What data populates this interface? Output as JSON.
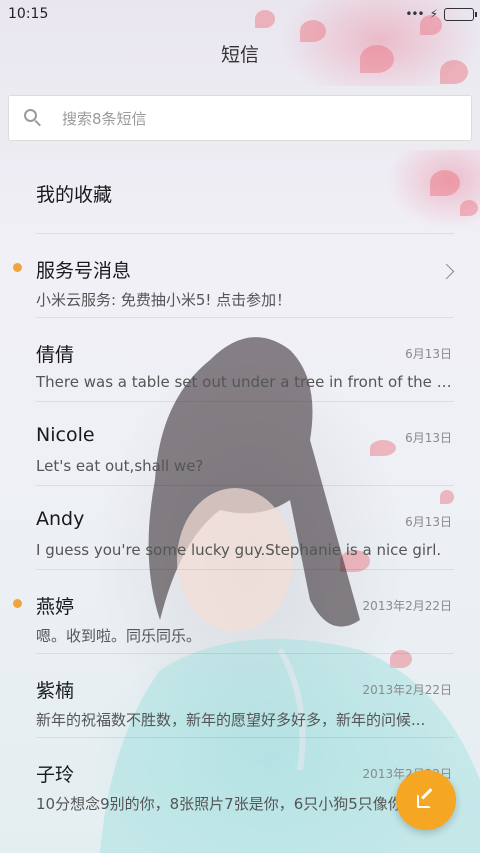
{
  "status_bar": {
    "time": "10:15",
    "icons": [
      "signal-dots-icon",
      "charging-bolt-icon",
      "battery-icon"
    ],
    "battery_color": "#4ccf3b"
  },
  "header": {
    "title": "短信"
  },
  "search": {
    "placeholder": "搜索8条短信",
    "icon": "search-icon"
  },
  "conversations": [
    {
      "name": "我的收藏",
      "preview": "",
      "date": "",
      "unread": false,
      "chevron": false
    },
    {
      "name": "服务号消息",
      "preview": "小米云服务: 免费抽小米5! 点击参加！",
      "date": "",
      "unread": true,
      "chevron": true
    },
    {
      "name": "倩倩",
      "preview": "There was a table set out under a tree in front of the ho...",
      "date": "6月13日",
      "unread": false,
      "chevron": false
    },
    {
      "name": "Nicole",
      "preview": "Let's eat out,shall we?",
      "date": "6月13日",
      "unread": false,
      "chevron": false
    },
    {
      "name": "Andy",
      "preview": "I guess you're some lucky guy.Stephanie is a nice girl.",
      "date": "6月13日",
      "unread": false,
      "chevron": false
    },
    {
      "name": "燕婷",
      "preview": "嗯。收到啦。同乐同乐。",
      "date": "2013年2月22日",
      "unread": true,
      "chevron": false
    },
    {
      "name": "紫楠",
      "preview": "新年的祝福数不胜数，新年的愿望好多好多，新年的问候...",
      "date": "2013年2月22日",
      "unread": false,
      "chevron": false
    },
    {
      "name": "子玲",
      "preview": "10分想念9别的你，8张照片7张是你，6只小狗5只像你",
      "date": "2013年2月22日",
      "unread": false,
      "chevron": false
    }
  ],
  "fab": {
    "icon": "compose-icon",
    "color": "#f5a623"
  },
  "colors": {
    "unread_dot": "#f0a53c"
  }
}
